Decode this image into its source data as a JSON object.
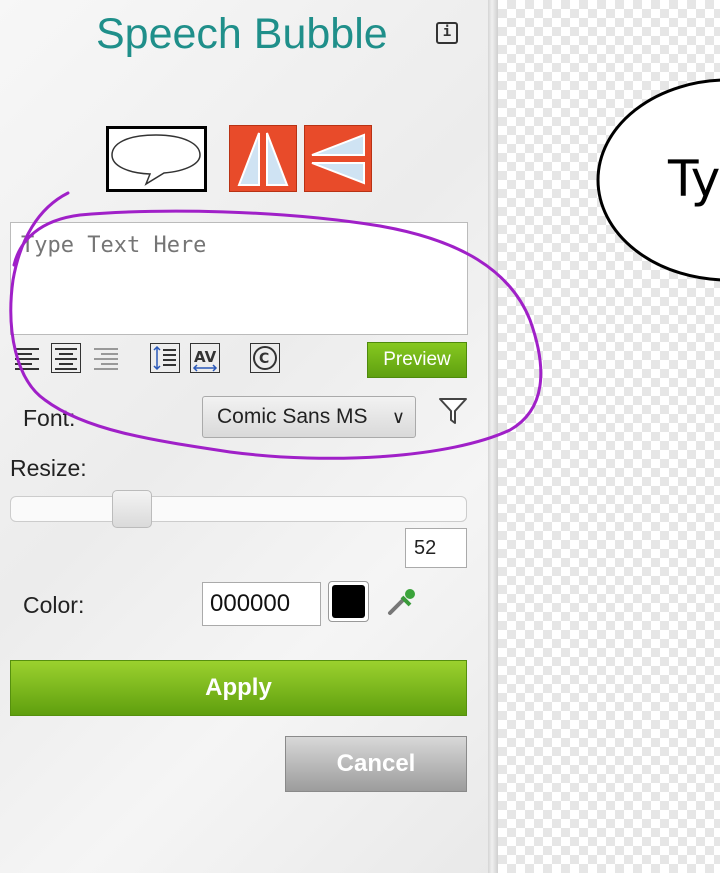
{
  "panel": {
    "title": "Speech Bubble",
    "info_icon": "info-icon",
    "shape_buttons": [
      {
        "name": "speech-bubble-shape-icon"
      },
      {
        "name": "flip-horizontal-icon"
      },
      {
        "name": "flip-vertical-icon"
      }
    ],
    "text_placeholder": "Type Text Here",
    "toolbar": [
      {
        "name": "align-left-icon"
      },
      {
        "name": "align-center-icon"
      },
      {
        "name": "align-right-icon"
      },
      {
        "name": "line-spacing-icon"
      },
      {
        "name": "letter-spacing-icon"
      },
      {
        "name": "copyright-icon"
      }
    ],
    "preview_label": "Preview",
    "font_label": "Font:",
    "font_value": "Comic Sans MS",
    "filter_icon": "filter-icon",
    "resize_label": "Resize:",
    "resize_value": "52",
    "color_label": "Color:",
    "color_value": "000000",
    "color_swatch": "#000000",
    "eyedropper_icon": "eyedropper-icon",
    "apply_label": "Apply",
    "cancel_label": "Cancel"
  },
  "canvas": {
    "bubble_text": "Ty"
  },
  "annotation": {
    "color": "#a020c8"
  }
}
